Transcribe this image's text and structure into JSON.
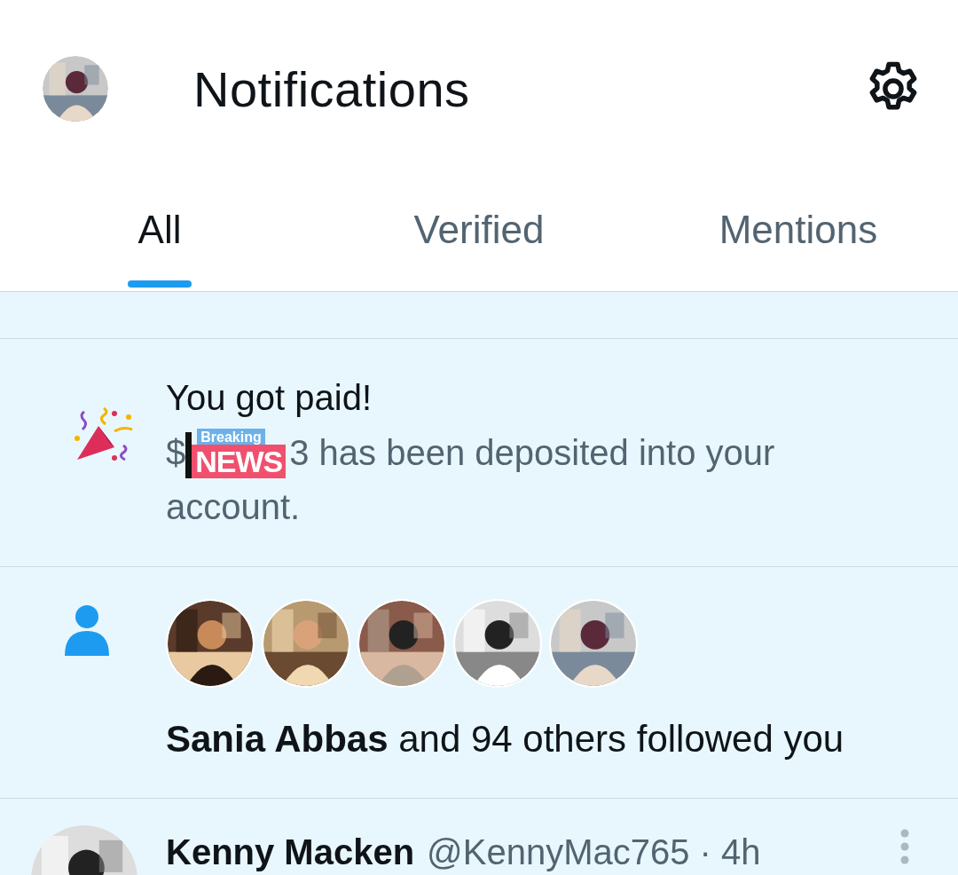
{
  "header": {
    "title": "Notifications"
  },
  "tabs": [
    {
      "label": "All",
      "selected": true
    },
    {
      "label": "Verified",
      "selected": false
    },
    {
      "label": "Mentions",
      "selected": false
    }
  ],
  "notifications": [
    {
      "kind": "payment",
      "title": "You got paid!",
      "body_prefix": "$",
      "sticker": {
        "top": "Breaking",
        "bottom": "NEWS"
      },
      "body_lines": [
        "3 has been deposited into your",
        "account."
      ]
    },
    {
      "kind": "follow",
      "actor": "Sania Abbas",
      "text": "and 94 others followed you"
    }
  ],
  "post": {
    "name": "Kenny Macken",
    "handle": "@KennyMac765",
    "separator": "·",
    "time": "4h"
  }
}
